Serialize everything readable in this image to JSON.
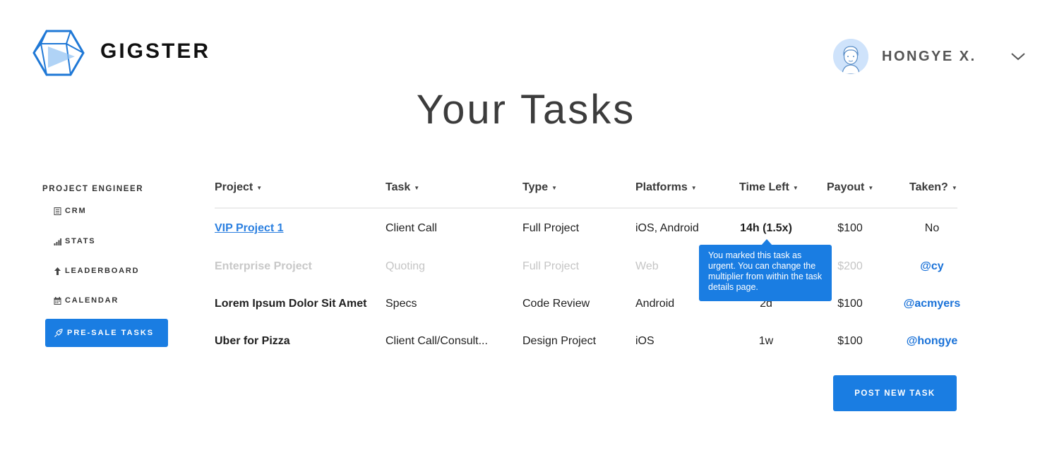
{
  "brand": {
    "name": "GIGSTER"
  },
  "user": {
    "name": "HONGYE X."
  },
  "page": {
    "title": "Your Tasks"
  },
  "sidebar": {
    "heading": "PROJECT ENGINEER",
    "items": [
      {
        "label": "CRM",
        "icon": "document-icon"
      },
      {
        "label": "STATS",
        "icon": "bar-chart-icon"
      },
      {
        "label": "LEADERBOARD",
        "icon": "arrow-up-icon"
      },
      {
        "label": "CALENDAR",
        "icon": "calendar-icon"
      }
    ],
    "active": {
      "label": "PRE-SALE TASKS",
      "icon": "rocket-icon"
    }
  },
  "table": {
    "columns": [
      "Project",
      "Task",
      "Type",
      "Platforms",
      "Time Left",
      "Payout",
      "Taken?"
    ],
    "rows": [
      {
        "project": "VIP Project 1",
        "task": "Client Call",
        "type": "Full Project",
        "platforms": "iOS, Android",
        "time_left": "14h (1.5x)",
        "payout": "$100",
        "taken": "No"
      },
      {
        "project": "Enterprise Project",
        "task": "Quoting",
        "type": "Full Project",
        "platforms": "Web",
        "time_left": "",
        "payout": "$200",
        "taken": "@cy"
      },
      {
        "project": "Lorem Ipsum Dolor Sit Amet",
        "task": "Specs",
        "type": "Code Review",
        "platforms": "Android",
        "time_left": "2d",
        "payout": "$100",
        "taken": "@acmyers"
      },
      {
        "project": "Uber for Pizza",
        "task": "Client Call/Consult...",
        "type": "Design Project",
        "platforms": "iOS",
        "time_left": "1w",
        "payout": "$100",
        "taken": "@hongye"
      }
    ]
  },
  "tooltip": {
    "text": "You marked this task as urgent. You can change the multiplier from within the task details page."
  },
  "actions": {
    "post_new_task": "POST NEW TASK"
  },
  "colors": {
    "accent": "#1a7de2",
    "link": "#2a7fe0",
    "muted": "#c5c5c5"
  }
}
